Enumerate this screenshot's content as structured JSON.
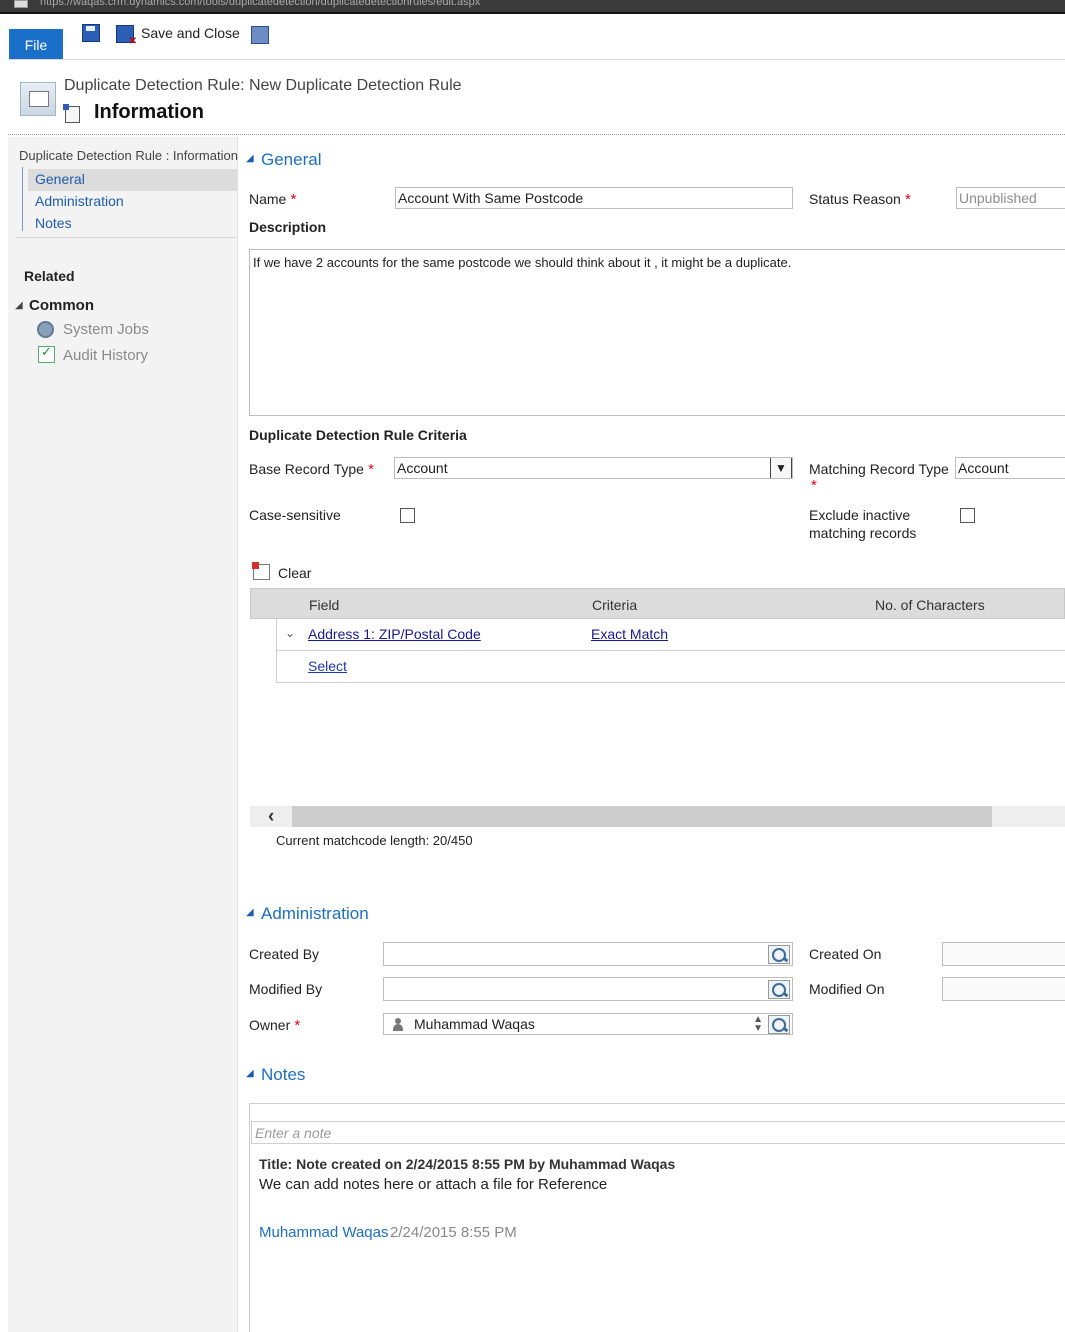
{
  "address_bar": {
    "url": "https://waqas.crm.dynamics.com/tools/duplicatedetection/duplicatedetectionrules/edit.aspx"
  },
  "ribbon": {
    "file_label": "File",
    "save_close_label": "Save and Close"
  },
  "header": {
    "subtitle": "Duplicate Detection Rule: New Duplicate Detection Rule",
    "title": "Information"
  },
  "left_nav": {
    "title": "Duplicate Detection Rule : Information",
    "items": [
      {
        "label": "General"
      },
      {
        "label": "Administration"
      },
      {
        "label": "Notes"
      }
    ],
    "related_label": "Related",
    "common_label": "Common",
    "related_items": [
      {
        "label": "System Jobs",
        "icon": "gear-icon"
      },
      {
        "label": "Audit History",
        "icon": "audit-icon"
      }
    ]
  },
  "general": {
    "section_title": "General",
    "name_label": "Name",
    "name_value": "Account With Same Postcode",
    "status_reason_label": "Status Reason",
    "status_reason_value": "Unpublished",
    "description_label": "Description",
    "description_value": "If we have 2 accounts for the same postcode we should think about it , it might be a duplicate."
  },
  "criteria": {
    "heading": "Duplicate Detection Rule Criteria",
    "base_record_type_label": "Base Record Type",
    "base_record_type_value": "Account",
    "matching_record_type_label": "Matching Record Type",
    "matching_record_type_value": "Account",
    "case_sensitive_label": "Case-sensitive",
    "exclude_inactive_label_1": "Exclude inactive",
    "exclude_inactive_label_2": "matching records",
    "clear_label": "Clear",
    "columns": {
      "field": "Field",
      "criteria": "Criteria",
      "chars": "No. of Characters"
    },
    "rows": [
      {
        "field": "Address 1: ZIP/Postal Code",
        "criteria": "Exact Match"
      }
    ],
    "select_label": "Select",
    "matchcode_length": "Current matchcode length: 20/450"
  },
  "administration": {
    "section_title": "Administration",
    "created_by_label": "Created By",
    "created_by_value": "",
    "created_on_label": "Created On",
    "modified_by_label": "Modified By",
    "modified_by_value": "",
    "modified_on_label": "Modified On",
    "owner_label": "Owner",
    "owner_value": "Muhammad Waqas"
  },
  "notes": {
    "section_title": "Notes",
    "placeholder": "Enter a note",
    "note_title": "Title: Note created on 2/24/2015 8:55 PM by Muhammad Waqas",
    "note_text": "We can add notes here or attach a file for Reference",
    "note_author": "Muhammad Waqas",
    "note_date": "2/24/2015 8:55 PM"
  },
  "colors": {
    "accent": "#1e6ec0",
    "file_button": "#1a6fc9",
    "required": "#e0001b"
  }
}
